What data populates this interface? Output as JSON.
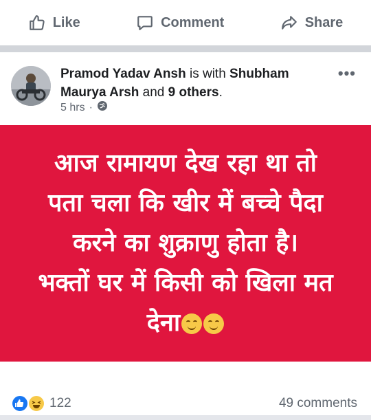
{
  "actions": {
    "like_label": "Like",
    "comment_label": "Comment",
    "share_label": "Share"
  },
  "post": {
    "author": "Pramod Yadav Ansh",
    "with_text": "is with",
    "tagged_person": "Shubham Maurya Arsh",
    "and_text": "and",
    "others": "9 others",
    "punct": ".",
    "time": "5 hrs",
    "separator": "·",
    "privacy_icon": "globe-icon",
    "lines": [
      "आज रामायण देख रहा था तो",
      "पता चला कि खीर में बच्चे पैदा",
      "करने का शुक्राणु होता है।",
      "भक्तों घर में किसी को खिला मत",
      "देना"
    ],
    "emojis": [
      "smiling-face-emoji",
      "smiling-face-emoji"
    ]
  },
  "footer": {
    "reaction_count": "122",
    "comment_count": "49 comments",
    "reaction_icons": [
      "like-reaction-icon",
      "haha-reaction-icon"
    ]
  },
  "colors": {
    "post_background": "#e0163e",
    "post_text": "#ffffff",
    "secondary_text": "#606770",
    "like_blue": "#1877f2"
  }
}
